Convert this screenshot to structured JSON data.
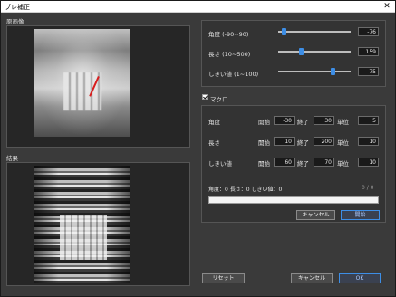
{
  "window": {
    "title": "ブレ補正",
    "close_glyph": "✕"
  },
  "source": {
    "label": "原画像"
  },
  "result": {
    "label": "結果"
  },
  "params": [
    {
      "label": "角度 (-90~90)",
      "value": "-76",
      "level": 0.08
    },
    {
      "label": "長さ (10~500)",
      "value": "159",
      "level": 0.31
    },
    {
      "label": "しきい値 (1~100)",
      "value": "75",
      "level": 0.75
    }
  ],
  "macro": {
    "label": "マクロ",
    "checked": true,
    "col_start": "開始",
    "col_end": "終了",
    "col_step": "単位",
    "rows": [
      {
        "label": "角度",
        "start": "-30",
        "end": "30",
        "step": "5"
      },
      {
        "label": "長さ",
        "start": "10",
        "end": "200",
        "step": "10"
      },
      {
        "label": "しきい値",
        "start": "60",
        "end": "70",
        "step": "10"
      }
    ],
    "status": "角度：0 長さ：0 しきい値：0",
    "counter": "0 / 0",
    "progress": 0,
    "cancel_label": "キャンセル",
    "start_label": "開始"
  },
  "footer": {
    "reset_label": "リセット",
    "cancel_label": "キャンセル",
    "ok_label": "OK"
  },
  "colors": {
    "accent": "#3d8ee6",
    "marker": "#d81e1e"
  }
}
